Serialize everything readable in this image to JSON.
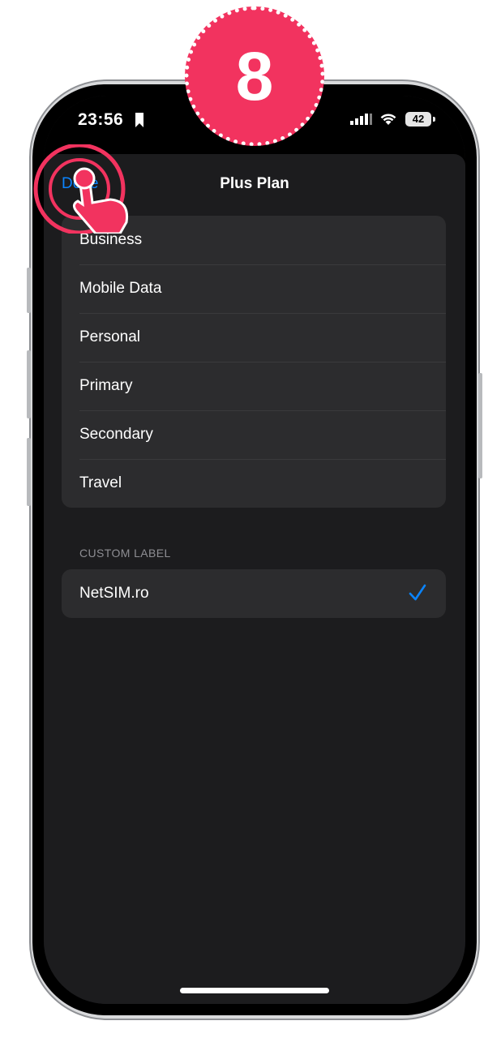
{
  "step_badge": "8",
  "status_bar": {
    "time": "23:56",
    "battery": "42",
    "icons": [
      "bookmark-icon",
      "cellular-signal-icon",
      "wifi-icon",
      "battery-icon"
    ]
  },
  "nav": {
    "done_label": "Done",
    "title": "Plus Plan"
  },
  "label_options": [
    {
      "label": "Business"
    },
    {
      "label": "Mobile Data"
    },
    {
      "label": "Personal"
    },
    {
      "label": "Primary"
    },
    {
      "label": "Secondary"
    },
    {
      "label": "Travel"
    }
  ],
  "custom_section": {
    "header": "CUSTOM LABEL",
    "value": "NetSIM.ro",
    "selected": true
  },
  "colors": {
    "accent": "#0a84ff",
    "sheet_background": "#1c1c1e",
    "cell_background": "#2c2c2e",
    "badge": "#f2335f"
  }
}
